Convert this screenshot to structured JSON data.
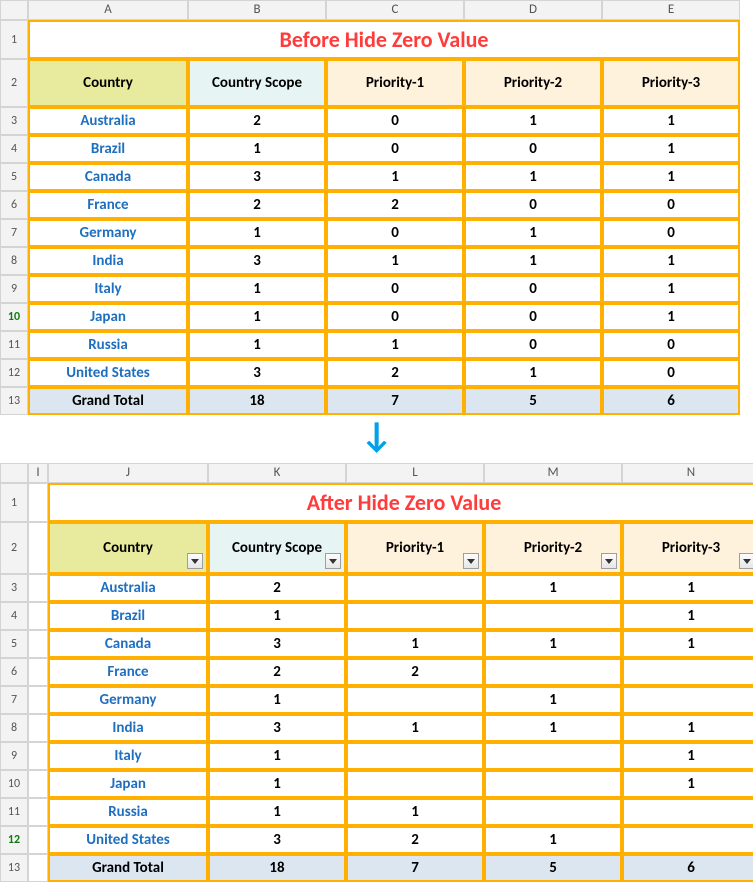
{
  "columns1": [
    "A",
    "B",
    "C",
    "D",
    "E"
  ],
  "columns2": [
    "I",
    "J",
    "K",
    "L",
    "M",
    "N"
  ],
  "rowNums": [
    "1",
    "2",
    "3",
    "4",
    "5",
    "6",
    "7",
    "8",
    "9",
    "10",
    "11",
    "12",
    "13"
  ],
  "greenRow1": "10",
  "greenRow2": "12",
  "title1": "Before Hide Zero Value",
  "title2": "After Hide Zero Value",
  "headers": {
    "country": "Country",
    "scope": "Country Scope",
    "p1": "Priority-1",
    "p2": "Priority-2",
    "p3": "Priority-3"
  },
  "rows1": [
    {
      "country": "Australia",
      "scope": "2",
      "p1": "0",
      "p2": "1",
      "p3": "1"
    },
    {
      "country": "Brazil",
      "scope": "1",
      "p1": "0",
      "p2": "0",
      "p3": "1"
    },
    {
      "country": "Canada",
      "scope": "3",
      "p1": "1",
      "p2": "1",
      "p3": "1"
    },
    {
      "country": "France",
      "scope": "2",
      "p1": "2",
      "p2": "0",
      "p3": "0"
    },
    {
      "country": "Germany",
      "scope": "1",
      "p1": "0",
      "p2": "1",
      "p3": "0"
    },
    {
      "country": "India",
      "scope": "3",
      "p1": "1",
      "p2": "1",
      "p3": "1"
    },
    {
      "country": "Italy",
      "scope": "1",
      "p1": "0",
      "p2": "0",
      "p3": "1"
    },
    {
      "country": "Japan",
      "scope": "1",
      "p1": "0",
      "p2": "0",
      "p3": "1"
    },
    {
      "country": "Russia",
      "scope": "1",
      "p1": "1",
      "p2": "0",
      "p3": "0"
    },
    {
      "country": "United States",
      "scope": "3",
      "p1": "2",
      "p2": "1",
      "p3": "0"
    }
  ],
  "total1": {
    "label": "Grand Total",
    "scope": "18",
    "p1": "7",
    "p2": "5",
    "p3": "6"
  },
  "rows2": [
    {
      "country": "Australia",
      "scope": "2",
      "p1": "",
      "p2": "1",
      "p3": "1"
    },
    {
      "country": "Brazil",
      "scope": "1",
      "p1": "",
      "p2": "",
      "p3": "1"
    },
    {
      "country": "Canada",
      "scope": "3",
      "p1": "1",
      "p2": "1",
      "p3": "1"
    },
    {
      "country": "France",
      "scope": "2",
      "p1": "2",
      "p2": "",
      "p3": ""
    },
    {
      "country": "Germany",
      "scope": "1",
      "p1": "",
      "p2": "1",
      "p3": ""
    },
    {
      "country": "India",
      "scope": "3",
      "p1": "1",
      "p2": "1",
      "p3": "1"
    },
    {
      "country": "Italy",
      "scope": "1",
      "p1": "",
      "p2": "",
      "p3": "1"
    },
    {
      "country": "Japan",
      "scope": "1",
      "p1": "",
      "p2": "",
      "p3": "1"
    },
    {
      "country": "Russia",
      "scope": "1",
      "p1": "1",
      "p2": "",
      "p3": ""
    },
    {
      "country": "United States",
      "scope": "3",
      "p1": "2",
      "p2": "1",
      "p3": ""
    }
  ],
  "total2": {
    "label": "Grand Total",
    "scope": "18",
    "p1": "7",
    "p2": "5",
    "p3": "6"
  },
  "arrow": "↓"
}
